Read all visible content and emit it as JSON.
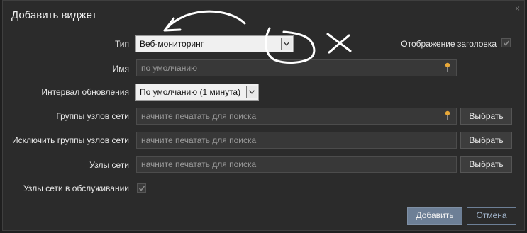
{
  "dialog": {
    "title": "Добавить виджет",
    "close_label": "×"
  },
  "form": {
    "type": {
      "label": "Тип",
      "value": "Веб-мониторинг"
    },
    "show_header": {
      "label": "Отображение заголовка",
      "checked": true
    },
    "name": {
      "label": "Имя",
      "placeholder": "по умолчанию"
    },
    "refresh": {
      "label": "Интервал обновления",
      "value": "По умолчанию (1 минута)"
    },
    "host_groups": {
      "label": "Группы узлов сети",
      "placeholder": "начните печатать для поиска",
      "button": "Выбрать"
    },
    "exclude_groups": {
      "label": "Исключить группы узлов сети",
      "placeholder": "начните печатать для поиска",
      "button": "Выбрать"
    },
    "hosts": {
      "label": "Узлы сети",
      "placeholder": "начните печатать для поиска",
      "button": "Выбрать"
    },
    "maintenance": {
      "label": "Узлы сети в обслуживании",
      "checked": true
    }
  },
  "footer": {
    "add_label": "Добавить",
    "cancel_label": "Отмена"
  },
  "colors": {
    "accent": "#6d7f96",
    "pin": "#e8a838",
    "annotation": "#ffffff"
  }
}
